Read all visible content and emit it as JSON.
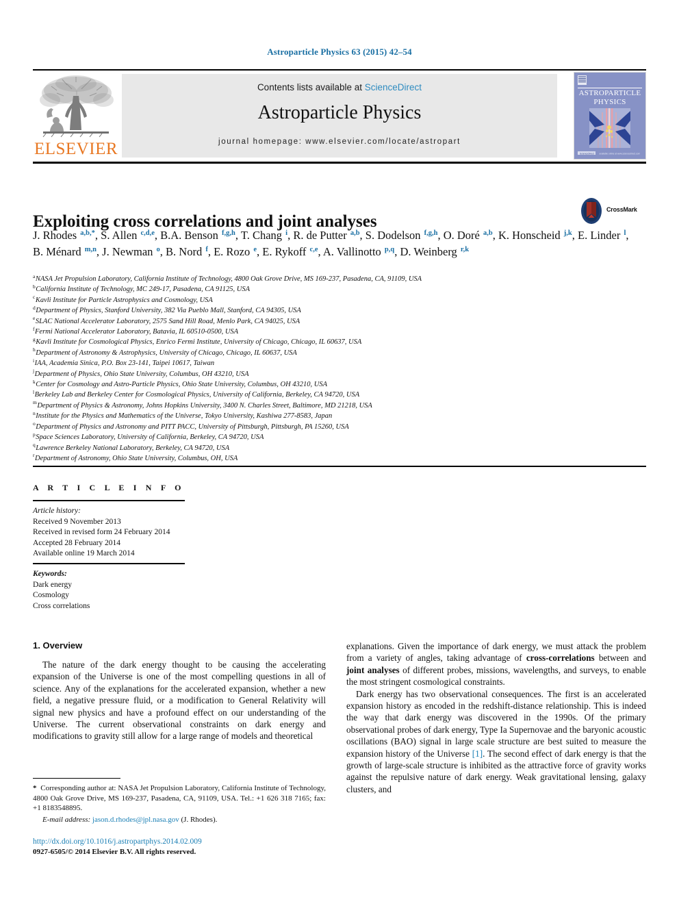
{
  "running_head": "Astroparticle Physics 63 (2015) 42–54",
  "masthead": {
    "contents_prefix": "Contents lists available at ",
    "sciencedirect_link": "ScienceDirect",
    "journal_name": "Astroparticle Physics",
    "homepage_line": "journal homepage: www.elsevier.com/locate/astropart",
    "publisher_wordmark": "ELSEVIER",
    "cover_title_line1": "ASTROPARTICLE",
    "cover_title_line2": "PHYSICS",
    "colors": {
      "link": "#2e8bc0",
      "running_head": "#1a6fa3",
      "elsevier_orange": "#e87722",
      "contents_box_bg": "#e8e8e8",
      "cover_bg": "#7f8fc4",
      "crossmark_circle": "#1f3f73",
      "crossmark_book": "#8c2b24"
    }
  },
  "article": {
    "title": "Exploiting cross correlations and joint analyses",
    "crossmark_label": "CrossMark",
    "authors_html": "J. Rhodes <sup>a,b,*</sup>, S. Allen <sup>c,d,e</sup>, B.A. Benson <sup>f,g,h</sup>, T. Chang <sup>i</sup>, R. de Putter <sup>a,b</sup>, S. Dodelson <sup>f,g,h</sup>, O. Doré <sup>a,b</sup>, K. Honscheid <sup>j,k</sup>, E. Linder <sup>l</sup>, B. Ménard <sup>m,n</sup>, J. Newman <sup>o</sup>, B. Nord <sup>f</sup>, E. Rozo <sup>e</sup>, E. Rykoff <sup>c,e</sup>, A. Vallinotto <sup>p,q</sup>, D. Weinberg <sup>r,k</sup>",
    "affiliations": [
      {
        "marker": "a",
        "text": "NASA Jet Propulsion Laboratory, California Institute of Technology, 4800 Oak Grove Drive, MS 169-237, Pasadena, CA, 91109, USA"
      },
      {
        "marker": "b",
        "text": "California Institute of Technology, MC 249-17, Pasadena, CA 91125, USA"
      },
      {
        "marker": "c",
        "text": "Kavli Institute for Particle Astrophysics and Cosmology, USA"
      },
      {
        "marker": "d",
        "text": "Department of Physics, Stanford University, 382 Via Pueblo Mall, Stanford, CA 94305, USA"
      },
      {
        "marker": "e",
        "text": "SLAC National Accelerator Laboratory, 2575 Sand Hill Road, Menlo Park, CA 94025, USA"
      },
      {
        "marker": "f",
        "text": "Fermi National Accelerator Laboratory, Batavia, IL 60510-0500, USA"
      },
      {
        "marker": "g",
        "text": "Kavli Institute for Cosmological Physics, Enrico Fermi Institute, University of Chicago, Chicago, IL 60637, USA"
      },
      {
        "marker": "h",
        "text": "Department of Astronomy & Astrophysics, University of Chicago, Chicago, IL 60637, USA"
      },
      {
        "marker": "i",
        "text": "IAA, Academia Sinica, P.O. Box 23-141, Taipei 10617, Taiwan"
      },
      {
        "marker": "j",
        "text": "Department of Physics, Ohio State University, Columbus, OH 43210, USA"
      },
      {
        "marker": "k",
        "text": "Center for Cosmology and Astro-Particle Physics, Ohio State University, Columbus, OH 43210, USA"
      },
      {
        "marker": "l",
        "text": "Berkeley Lab and Berkeley Center for Cosmological Physics, University of California, Berkeley, CA 94720, USA"
      },
      {
        "marker": "m",
        "text": "Department of Physics & Astronomy, Johns Hopkins University, 3400 N. Charles Street, Baltimore, MD 21218, USA"
      },
      {
        "marker": "n",
        "text": "Institute for the Physics and Mathematics of the Universe, Tokyo University, Kashiwa 277-8583, Japan"
      },
      {
        "marker": "o",
        "text": "Department of Physics and Astronomy and PITT PACC, University of Pittsburgh, Pittsburgh, PA 15260, USA"
      },
      {
        "marker": "p",
        "text": "Space Sciences Laboratory, University of California, Berkeley, CA 94720, USA"
      },
      {
        "marker": "q",
        "text": "Lawrence Berkeley National Laboratory, Berkeley, CA 94720, USA"
      },
      {
        "marker": "r",
        "text": "Department of Astronomy, Ohio State University, Columbus, OH, USA"
      }
    ]
  },
  "article_info": {
    "heading": "A R T I C L E   I N F O",
    "history_label": "Article history:",
    "history": [
      "Received 9 November 2013",
      "Received in revised form 24 February 2014",
      "Accepted 28 February 2014",
      "Available online 19 March 2014"
    ],
    "keywords_label": "Keywords:",
    "keywords": [
      "Dark energy",
      "Cosmology",
      "Cross correlations"
    ]
  },
  "body": {
    "section_number_title": "1. Overview",
    "left_paragraph_1": "The nature of the dark energy thought to be causing the accelerating expansion of the Universe is one of the most compelling questions in all of science. Any of the explanations for the accelerated expansion, whether a new field, a negative pressure fluid, or a modification to General Relativity will signal new physics and have a profound effect on our understanding of the Universe. The current observational constraints on dark energy and modifications to gravity still allow for a large range of models and theoretical",
    "right_paragraph_1_html": "explanations. Given the importance of dark energy, we must attack the problem from a variety of angles, taking advantage of <span class=\"b\">cross-correlations</span> between and <span class=\"b\">joint analyses</span> of different probes, missions, wavelengths, and surveys, to enable the most stringent cosmological constraints.",
    "right_paragraph_2_html": "Dark energy has two observational consequences. The first is an accelerated expansion history as encoded in the redshift-distance relationship. This is indeed the way that dark energy was discovered in the 1990s. Of the primary observational probes of dark energy, Type Ia Supernovae and the baryonic acoustic oscillations (BAO) signal in large scale structure are best suited to measure the expansion history of the Universe <span class=\"ref-link\">[1]</span>. The second effect of dark energy is that the growth of large-scale structure is inhibited as the attractive force of gravity works against the repulsive nature of dark energy. Weak gravitational lensing, galaxy clusters, and"
  },
  "footnotes": {
    "corresponding_html": "<span style=\"font-weight:bold\">*</span>&nbsp; Corresponding author at: NASA Jet Propulsion Laboratory, California Institute of Technology, 4800 Oak Grove Drive, MS 169-237, Pasadena, CA, 91109, USA. Tel.: +1 626 318 7165; fax: +1 8183548895.",
    "email_label": "E-mail address:",
    "email": "jason.d.rhodes@jpl.nasa.gov",
    "email_suffix": "(J. Rhodes).",
    "doi": "http://dx.doi.org/10.1016/j.astropartphys.2014.02.009",
    "copyright": "0927-6505/© 2014 Elsevier B.V. All rights reserved."
  }
}
